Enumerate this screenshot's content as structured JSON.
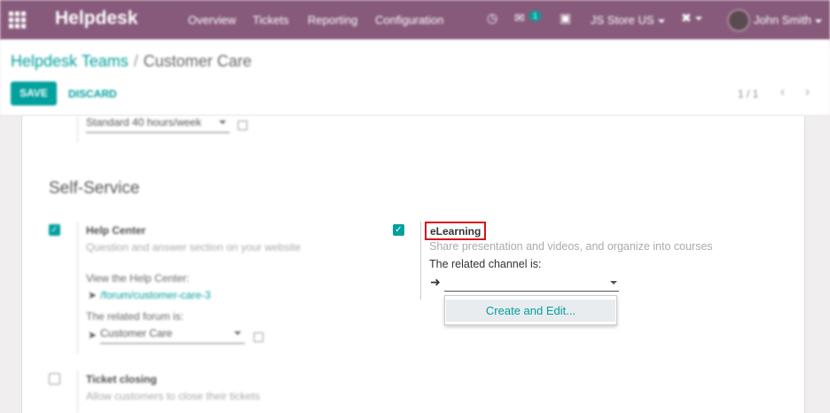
{
  "navbar": {
    "brand": "Helpdesk",
    "menu": [
      "Overview",
      "Tickets",
      "Reporting",
      "Configuration"
    ],
    "messages_count": "1",
    "company": "JS Store US",
    "user": "John Smith",
    "icons": [
      "apps-grid-icon",
      "clock-icon",
      "chat-icon",
      "gift-icon",
      "debug-icon"
    ]
  },
  "breadcrumb": {
    "parent": "Helpdesk Teams",
    "separator": "/",
    "current": "Customer Care"
  },
  "buttons": {
    "save": "SAVE",
    "discard": "DISCARD"
  },
  "pager": {
    "value": "1 / 1",
    "prev": "‹",
    "next": "›"
  },
  "form": {
    "working_hours": "Standard 40 hours/week",
    "section_title": "Self-Service",
    "help_center": {
      "title": "Help Center",
      "help": "Question and answer section on your website",
      "view_label": "View the Help Center:",
      "view_link": "/forum/customer-care-3",
      "forum_label": "The related forum is:",
      "forum_value": "Customer Care",
      "checked": true
    },
    "elearning": {
      "title": "eLearning",
      "help": "Share presentation and videos, and organize into courses",
      "channel_label": "The related channel is:",
      "channel_value": "",
      "checked": true,
      "dropdown_option": "Create and Edit..."
    },
    "ticket_closing": {
      "title": "Ticket closing",
      "help": "Allow customers to close their tickets",
      "checked": false
    }
  },
  "colors": {
    "navbar": "#875a7b",
    "accent": "#00a09d",
    "highlight_border": "#d8111a"
  }
}
